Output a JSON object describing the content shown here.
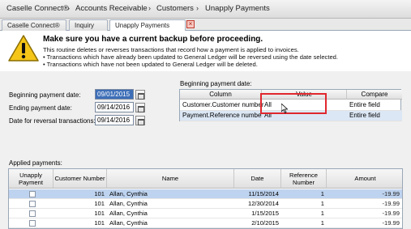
{
  "breadcrumb": {
    "items": [
      "Caselle Connect®",
      "Accounts Receivable",
      "Customers",
      "Unapply Payments"
    ],
    "separator": "›"
  },
  "tabs": [
    {
      "label": "Caselle Connect®"
    },
    {
      "label": "Inquiry"
    },
    {
      "label": "Unapply Payments"
    }
  ],
  "warning": {
    "title": "Make sure you have a current backup before proceeding.",
    "lines": [
      "This routine deletes or reverses transactions that record how a payment is applied to invoices.",
      "• Transactions which have already been updated to General Ledger will be reversed using the date selected.",
      "• Transactions which have not been updated to General Ledger will be deleted."
    ]
  },
  "form": {
    "begin_label": "Beginning payment date:",
    "begin_value": "09/01/2015",
    "end_label": "Ending payment date:",
    "end_value": "09/14/2016",
    "reversal_label": "Date for reversal transactions:",
    "reversal_value": "09/14/2016"
  },
  "filter": {
    "title": "Beginning payment date:",
    "columns": [
      "Column",
      "Value",
      "Compare"
    ],
    "rows": [
      {
        "column": "Customer.Customer number",
        "value": "All",
        "compare": "Entire field"
      },
      {
        "column": "Payment.Reference number",
        "value": "All",
        "compare": "Entire field"
      }
    ]
  },
  "applied": {
    "title": "Applied payments:",
    "columns": [
      "Unapply Payment",
      "Customer Number",
      "Name",
      "Date",
      "Reference Number",
      "Amount"
    ],
    "rows": [
      {
        "customer": "101",
        "name": "Allan, Cynthia",
        "date": "11/15/2014",
        "ref": "1",
        "amount": "-19.99"
      },
      {
        "customer": "101",
        "name": "Allan, Cynthia",
        "date": "12/30/2014",
        "ref": "1",
        "amount": "-19.99"
      },
      {
        "customer": "101",
        "name": "Allan, Cynthia",
        "date": "1/15/2015",
        "ref": "1",
        "amount": "-19.99"
      },
      {
        "customer": "101",
        "name": "Allan, Cynthia",
        "date": "2/10/2015",
        "ref": "1",
        "amount": "-19.99"
      }
    ]
  },
  "colors": {
    "accent": "#3d6fb8",
    "selected_row": "#bed3ef",
    "highlight_box": "#e0282e",
    "warning_yellow": "#f5c518"
  }
}
